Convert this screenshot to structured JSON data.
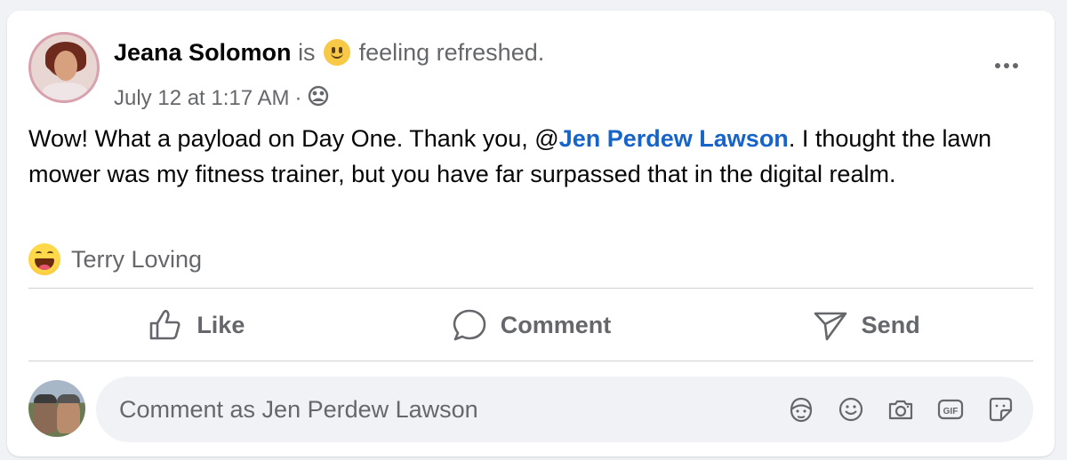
{
  "post": {
    "author": "Jeana Solomon",
    "is_text": "is",
    "feeling_text": "feeling refreshed.",
    "timestamp": "July 12 at 1:17 AM",
    "separator": "·",
    "audience_icon": "friends-icon",
    "more_icon": "more-icon",
    "text_before_mention": "Wow! What a payload on Day One. Thank you, @",
    "mention": "Jen Perdew Lawson",
    "text_after_mention": ". I thought the lawn mower was my fitness trainer, but you have far surpassed that in the digital realm."
  },
  "reactions": {
    "emoji": "haha-icon",
    "names": "Terry Loving"
  },
  "actions": {
    "like": "Like",
    "comment": "Comment",
    "send": "Send"
  },
  "comment_box": {
    "placeholder": "Comment as Jen Perdew Lawson",
    "icons": [
      "avatar-sticker-icon",
      "emoji-icon",
      "camera-icon",
      "gif-icon",
      "sticker-icon"
    ]
  },
  "colors": {
    "mention": "#1664c9",
    "muted": "#65676b",
    "divider": "#ced0d4",
    "comment_bg": "#f0f2f5"
  }
}
